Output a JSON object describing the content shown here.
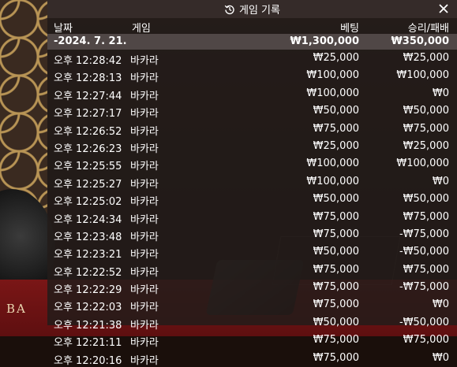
{
  "title": "게임 기록",
  "icons": {
    "history": "history-icon",
    "close": "close-icon"
  },
  "columns": {
    "date": "날짜",
    "game": "게임",
    "bet": "베팅",
    "result": "승리/패배"
  },
  "date_group": {
    "date": "-2024. 7. 21.",
    "total_bet": "₩1,300,000",
    "total_result": "₩350,000"
  },
  "rows": [
    {
      "time": "오후 12:28:42",
      "game": "바카라",
      "bet": "₩25,000",
      "result": "₩25,000"
    },
    {
      "time": "오후 12:28:13",
      "game": "바카라",
      "bet": "₩100,000",
      "result": "₩100,000"
    },
    {
      "time": "오후 12:27:44",
      "game": "바카라",
      "bet": "₩100,000",
      "result": "₩0"
    },
    {
      "time": "오후 12:27:17",
      "game": "바카라",
      "bet": "₩50,000",
      "result": "₩50,000"
    },
    {
      "time": "오후 12:26:52",
      "game": "바카라",
      "bet": "₩75,000",
      "result": "₩75,000"
    },
    {
      "time": "오후 12:26:23",
      "game": "바카라",
      "bet": "₩25,000",
      "result": "₩25,000"
    },
    {
      "time": "오후 12:25:55",
      "game": "바카라",
      "bet": "₩100,000",
      "result": "₩100,000"
    },
    {
      "time": "오후 12:25:27",
      "game": "바카라",
      "bet": "₩100,000",
      "result": "₩0"
    },
    {
      "time": "오후 12:25:02",
      "game": "바카라",
      "bet": "₩50,000",
      "result": "₩50,000"
    },
    {
      "time": "오후 12:24:34",
      "game": "바카라",
      "bet": "₩75,000",
      "result": "₩75,000"
    },
    {
      "time": "오후 12:23:48",
      "game": "바카라",
      "bet": "₩75,000",
      "result": "-₩75,000"
    },
    {
      "time": "오후 12:23:21",
      "game": "바카라",
      "bet": "₩50,000",
      "result": "-₩50,000"
    },
    {
      "time": "오후 12:22:52",
      "game": "바카라",
      "bet": "₩75,000",
      "result": "₩75,000"
    },
    {
      "time": "오후 12:22:29",
      "game": "바카라",
      "bet": "₩75,000",
      "result": "-₩75,000"
    },
    {
      "time": "오후 12:22:03",
      "game": "바카라",
      "bet": "₩75,000",
      "result": "₩0"
    },
    {
      "time": "오후 12:21:38",
      "game": "바카라",
      "bet": "₩50,000",
      "result": "-₩50,000"
    },
    {
      "time": "오후 12:21:11",
      "game": "바카라",
      "bet": "₩75,000",
      "result": "₩75,000"
    },
    {
      "time": "오후 12:20:16",
      "game": "바카라",
      "bet": "₩75,000",
      "result": "₩0"
    }
  ],
  "background": {
    "table_text": "BA"
  },
  "colors": {
    "panel": "#231c1a",
    "date_row": "#554b4a",
    "table_felt": "#7a1616"
  }
}
